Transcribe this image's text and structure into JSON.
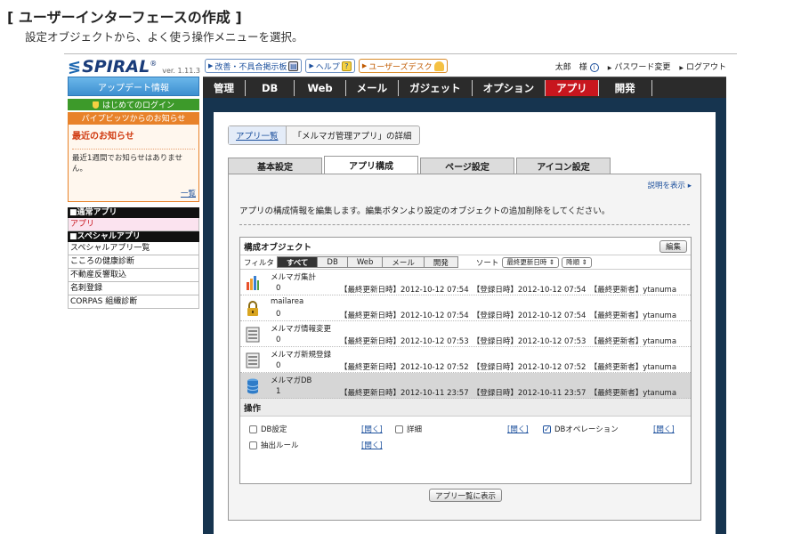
{
  "doc": {
    "title": "[ ユーザーインターフェースの作成 ]",
    "subtitle": "設定オブジェクトから、よく使う操作メニューを選択。"
  },
  "header": {
    "logo_text": "SPIRAL",
    "logo_reg": "®",
    "version": "ver. 1.11.3",
    "buttons": [
      {
        "label": "改善・不具合掲示板",
        "icon": "board-icon"
      },
      {
        "label": "ヘルプ",
        "icon": "help-icon"
      },
      {
        "label": "ユーザーズデスク",
        "icon": "bell-icon"
      }
    ],
    "user_name": "太郎　様",
    "info_icon": "i",
    "password_change": "パスワード変更",
    "logout": "ログアウト"
  },
  "nav": {
    "items": [
      "管理",
      "DB",
      "Web",
      "メール",
      "ガジェット",
      "オプション",
      "アプリ",
      "開発"
    ],
    "active_index": 6
  },
  "sidebar": {
    "update_label": "アップデート情報",
    "login_label": "はじめてのログイン",
    "news_head": "パイプビッツからのお知らせ",
    "news_title": "最近のお知らせ",
    "news_body": "最近1週間でお知らせはありません。",
    "news_more": "一覧",
    "groups": [
      {
        "head": "■通常アプリ",
        "items": [
          {
            "label": "アプリ",
            "selected": true
          }
        ]
      },
      {
        "head": "■スペシャルアプリ",
        "items": [
          {
            "label": "スペシャルアプリ一覧",
            "selected": false
          },
          {
            "label": "こころの健康診断",
            "selected": false
          },
          {
            "label": "不動産反響取込",
            "selected": false
          },
          {
            "label": "名刺登録",
            "selected": false
          },
          {
            "label": "CORPAS 組織診断",
            "selected": false
          }
        ]
      }
    ]
  },
  "breadcrumb": {
    "link": "アプリ一覧",
    "current": "「メルマガ管理アプリ」の詳細"
  },
  "tabs": [
    "基本設定",
    "アプリ構成",
    "ページ設定",
    "アイコン設定"
  ],
  "active_tab": 1,
  "explain_label": "説明を表示 ▸",
  "intro": "アプリの構成情報を編集します。編集ボタンより設定のオブジェクトの追加削除をしてください。",
  "objects_box": {
    "title": "構成オブジェクト",
    "edit_label": "編集",
    "filter_label": "フィルタ",
    "filters": [
      "すべて",
      "DB",
      "Web",
      "メール",
      "開発"
    ],
    "filter_selected": 0,
    "sort_label": "ソート",
    "sort_field": "最終更新日時",
    "sort_order": "降順",
    "rows": [
      {
        "name": "メルマガ集計",
        "count": "0",
        "meta": "【最終更新日時】2012-10-12 07:54　【登録日時】2012-10-12 07:54　【最終更新者】ytanuma",
        "icon": "chart-icon",
        "selected": false
      },
      {
        "name": "mailarea",
        "count": "0",
        "meta": "【最終更新日時】2012-10-12 07:54　【登録日時】2012-10-12 07:54　【最終更新者】ytanuma",
        "icon": "lock-icon",
        "selected": false
      },
      {
        "name": "メルマガ情報変更",
        "count": "0",
        "meta": "【最終更新日時】2012-10-12 07:53　【登録日時】2012-10-12 07:53　【最終更新者】ytanuma",
        "icon": "form-icon",
        "selected": false
      },
      {
        "name": "メルマガ新規登録",
        "count": "0",
        "meta": "【最終更新日時】2012-10-12 07:52　【登録日時】2012-10-12 07:52　【最終更新者】ytanuma",
        "icon": "form-icon",
        "selected": false
      },
      {
        "name": "メルマガDB",
        "count": "1",
        "meta": "【最終更新日時】2012-10-11 23:57　【登録日時】2012-10-11 23:57　【最終更新者】ytanuma",
        "icon": "database-icon",
        "selected": true
      }
    ],
    "ops_title": "操作",
    "ops": [
      {
        "label": "DB設定",
        "checked": false,
        "link": "[開く]"
      },
      {
        "label": "詳細",
        "checked": false,
        "link": "[開く]"
      },
      {
        "label": "DBオペレーション",
        "checked": true,
        "link": "[開く]"
      },
      {
        "label": "抽出ルール",
        "checked": false,
        "link": "[開く]"
      }
    ]
  },
  "list_button": "アプリ一覧に表示"
}
